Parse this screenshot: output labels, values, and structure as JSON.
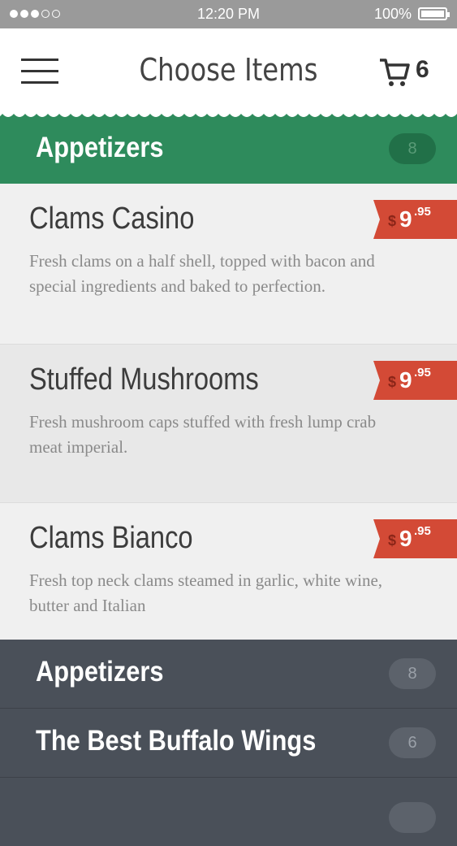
{
  "status_bar": {
    "time": "12:20 PM",
    "battery": "100%"
  },
  "header": {
    "title": "Choose Items",
    "cart_count": "6"
  },
  "active_section": {
    "title": "Appetizers",
    "count": "8"
  },
  "items": [
    {
      "name": "Clams Casino",
      "description": "Fresh clams on a half shell, topped with bacon and special ingredients and baked to perfection.",
      "currency": "$",
      "price_dollars": "9",
      "price_cents": ".95"
    },
    {
      "name": "Stuffed Mushrooms",
      "description": "Fresh mushroom caps stuffed with fresh lump crab meat imperial.",
      "currency": "$",
      "price_dollars": "9",
      "price_cents": ".95"
    },
    {
      "name": "Clams Bianco",
      "description": "Fresh top neck clams steamed in garlic, white wine, butter and Italian",
      "currency": "$",
      "price_dollars": "9",
      "price_cents": ".95"
    }
  ],
  "categories": [
    {
      "title": "Appetizers",
      "count": "8"
    },
    {
      "title": "The Best Buffalo Wings",
      "count": "6"
    }
  ],
  "colors": {
    "green": "#2e8b5c",
    "price_red": "#d34a36",
    "dark": "#4a5059"
  }
}
